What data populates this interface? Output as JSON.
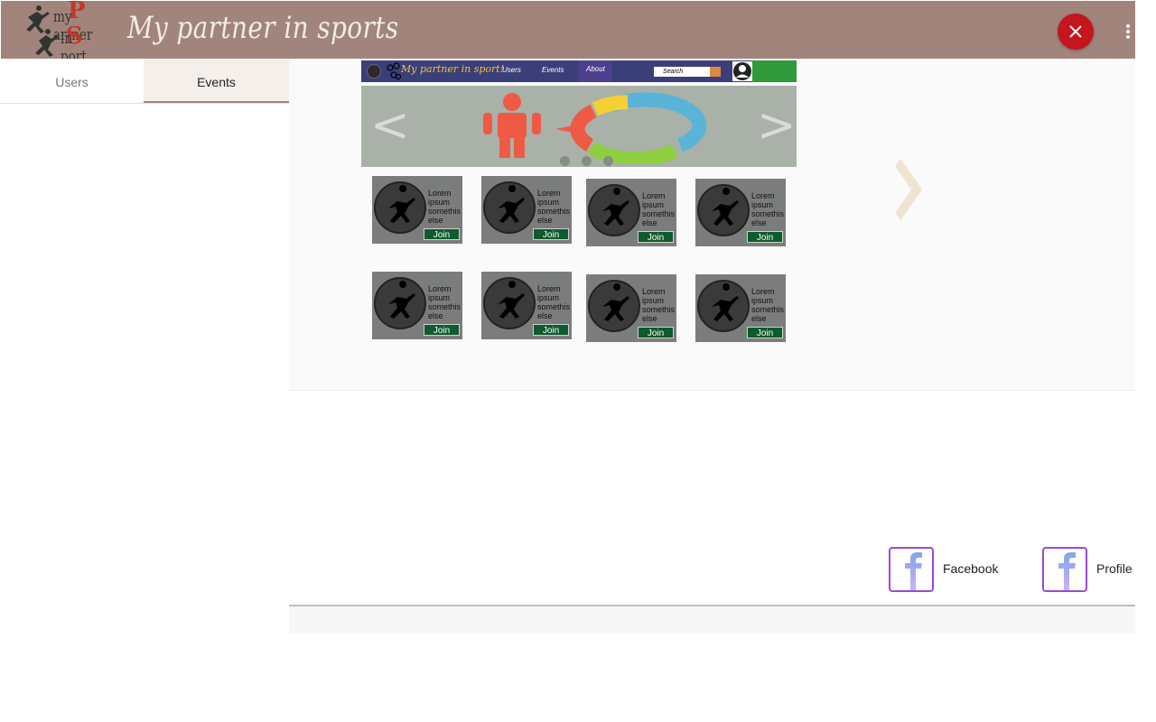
{
  "header": {
    "logo": {
      "line1": "my artner",
      "line2": "in port",
      "letter1": "P",
      "letter2": "S"
    },
    "title": "My partner in sports",
    "close_icon": "close-icon",
    "menu_icon": "more-vert-icon"
  },
  "tabs": [
    {
      "label": "Users",
      "active": false
    },
    {
      "label": "Events",
      "active": true
    }
  ],
  "preview": {
    "nav": {
      "logo_text": "My partner in sport!",
      "links": [
        "Users",
        "Events",
        "About"
      ],
      "search_placeholder": "Search"
    },
    "carousel": {
      "prev": "<",
      "next": ">",
      "dots": 3
    },
    "cards": [
      {
        "text": "Lorem ipsum somethis else",
        "button": "Join"
      },
      {
        "text": "Lorem ipsum somethis else",
        "button": "Join"
      },
      {
        "text": "Lorem ipsum somethis else",
        "button": "Join"
      },
      {
        "text": "Lorem ipsum somethis else",
        "button": "Join"
      },
      {
        "text": "Lorem ipsum somethis else",
        "button": "Join"
      },
      {
        "text": "Lorem ipsum somethis else",
        "button": "Join"
      },
      {
        "text": "Lorem ipsum somethis else",
        "button": "Join"
      },
      {
        "text": "Lorem ipsum somethis else",
        "button": "Join"
      }
    ]
  },
  "next_icon": "chevron-right-icon",
  "links": [
    {
      "label": "Facebook",
      "icon": "facebook-icon"
    },
    {
      "label": "Profile",
      "icon": "facebook-icon"
    }
  ],
  "colors": {
    "header_bg": "#a1857c",
    "close_button": "#c4161c",
    "join_button": "#0d5b2e",
    "icon_border": "#9a48d8"
  }
}
